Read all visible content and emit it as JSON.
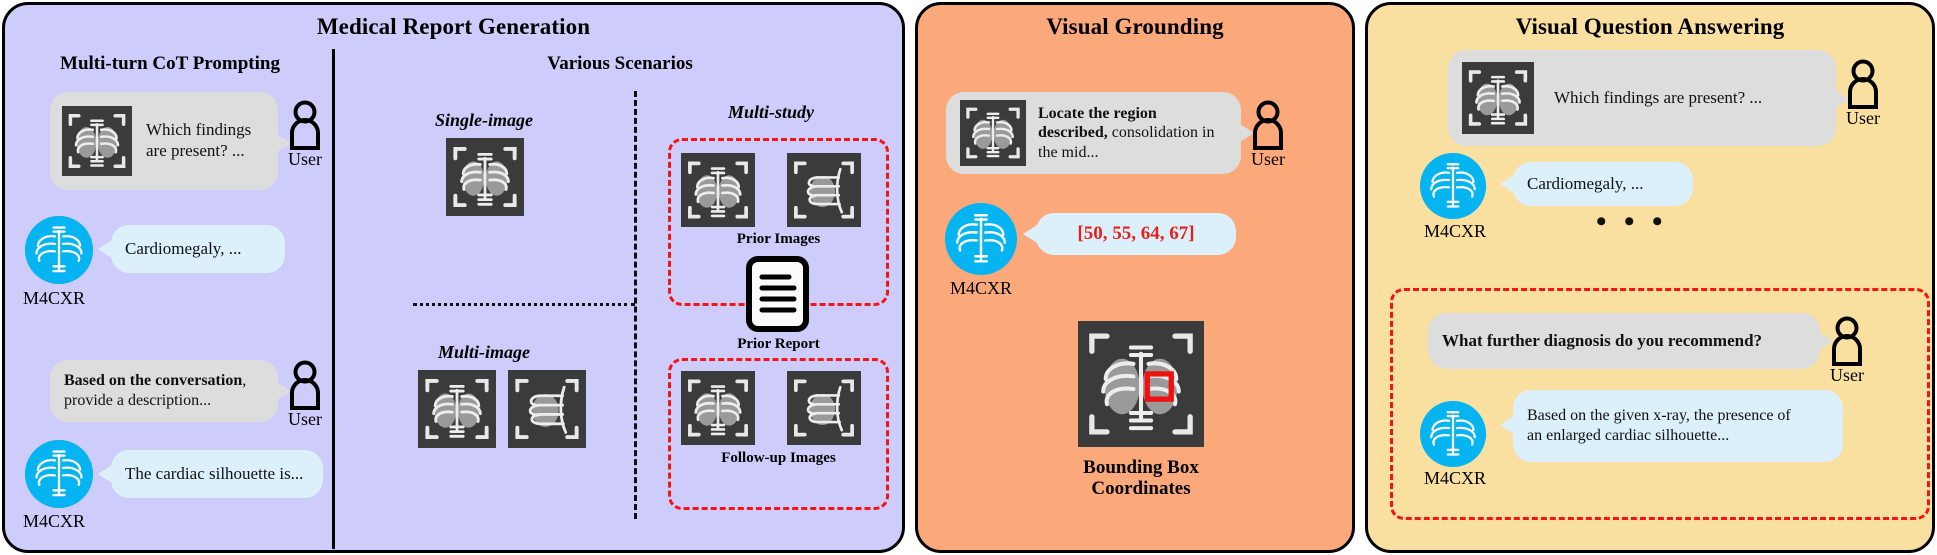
{
  "panels": {
    "mrg": {
      "title": "Medical Report Generation",
      "left_section_title": "Multi-turn CoT Prompting",
      "right_section_title": "Various Scenarios",
      "conversation": [
        {
          "role": "user",
          "bold": "",
          "text": "Which findings are present? ...",
          "has_image": true,
          "speaker": "User"
        },
        {
          "role": "model",
          "bold": "",
          "text": "Cardiomegaly, ...",
          "has_image": false,
          "speaker": "M4CXR"
        },
        {
          "role": "user",
          "bold": "Based on the conversation",
          "text": ", provide a description...",
          "has_image": false,
          "speaker": "User"
        },
        {
          "role": "model",
          "bold": "",
          "text": "The cardiac silhouette is...",
          "has_image": false,
          "speaker": "M4CXR"
        }
      ],
      "scenarios": {
        "single_image": "Single-image",
        "multi_image": "Multi-image",
        "multi_study": "Multi-study",
        "prior_images": "Prior Images",
        "prior_report": "Prior Report",
        "followup_images": "Follow-up Images"
      }
    },
    "vg": {
      "title": "Visual Grounding",
      "prompt_bold": "Locate the region described,",
      "prompt_rest": " consolidation in the mid...",
      "user_label": "User",
      "model_label": "M4CXR",
      "answer_coords": "[50, 55, 64, 67]",
      "bbox_caption_line1": "Bounding Box",
      "bbox_caption_line2": "Coordinates"
    },
    "vqa": {
      "title": "Visual Question Answering",
      "q1": "Which findings are present? ...",
      "a1": "Cardiomegaly, ...",
      "ellipsis": "• • •",
      "q2": "What further diagnosis do you recommend?",
      "a2_line1": "Based on the given x-ray, the presence of",
      "a2_line2": "an enlarged cardiac silhouette...",
      "user_label": "User",
      "model_label": "M4CXR"
    }
  },
  "colors": {
    "panel_mrg_bg": "#cdccfa",
    "panel_vg_bg": "#fba87b",
    "panel_vqa_bg": "#fae0a0",
    "user_bubble": "#dddddd",
    "model_bubble": "#dcf0fb",
    "avatar": "#05b4f0",
    "accent_red": "#f51414",
    "xray_bg": "#3b3b3b"
  }
}
